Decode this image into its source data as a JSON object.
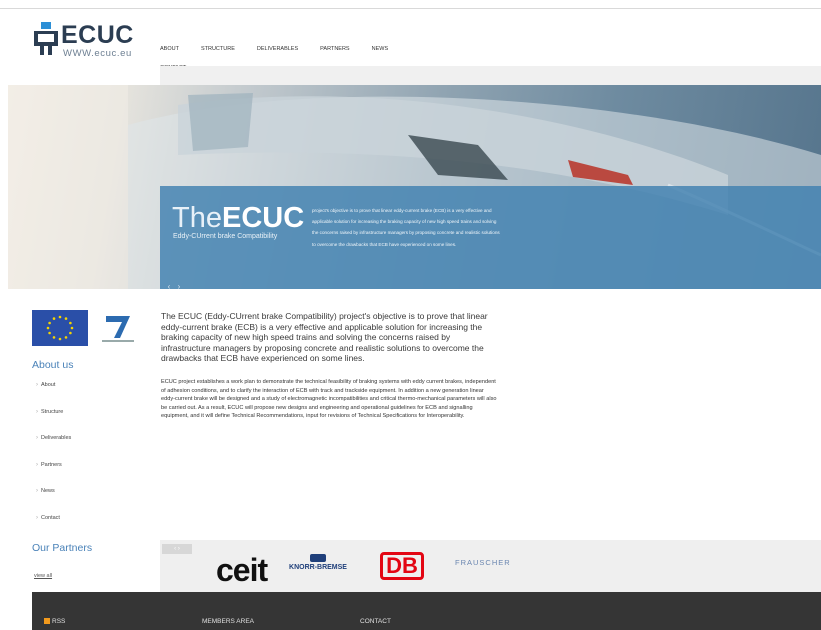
{
  "header": {
    "logo_text": "ECUC",
    "logo_url": "WWW.ecuc.eu",
    "nav": [
      "ABOUT",
      "STRUCTURE",
      "DELIVERABLES",
      "PARTNERS",
      "NEWS",
      "CONTACT"
    ]
  },
  "hero": {
    "title_light": "The",
    "title_bold": "ECUC",
    "subtitle": "Eddy-CUrrent brake Compatibility",
    "description": "project's objective is to prove that linear eddy-current brake (ECB) is a very effective and applicable solution for increasing the braking capacity of new high speed trains and solving the concerns raised by infrastructure managers by proposing concrete and realistic solutions to overcome the drawbacks that ECB have experienced on some lines."
  },
  "sidebar": {
    "about_title": "About us",
    "items": [
      "About",
      "Structure",
      "Deliverables",
      "Partners",
      "News",
      "Contact"
    ],
    "partners_title": "Our Partners",
    "view_all": "view all"
  },
  "main": {
    "intro": "The ECUC (Eddy-CUrrent brake Compatibility) project's objective is to prove that linear eddy-current brake (ECB) is a very effective and applicable solution for increasing the braking capacity of new high speed trains and solving the concerns raised by infrastructure managers by proposing concrete and realistic solutions to overcome the drawbacks that ECB have experienced on some lines.",
    "body": "ECUC project establishes a work plan to demonstrate the technical feasibility of braking systems with eddy current brakes, independent of adhesion conditions, and to clarify the interaction of ECB with track and trackside equipment. In addition a new generation linear eddy-current brake will be designed and a study of electromagnetic incompatibilities and critical thermo-mechanical parameters will also be carried out. As a result, ECUC will propose new designs and engineering and operational guidelines for ECB and signalling equipment, and it will define Technical Recommendations, input for revisions of Technical Specifications for Interoperability."
  },
  "partners": {
    "ceit": "ceit",
    "knorr": "KNORR-BREMSE",
    "db": "DB",
    "frauscher": "FRAUSCHER"
  },
  "footer": {
    "rss": "RSS",
    "members": "MEMBERS AREA",
    "contact": "CONTACT"
  },
  "colors": {
    "accent": "#4a82b8",
    "hero_box": "#4080b0",
    "footer": "#353535"
  }
}
